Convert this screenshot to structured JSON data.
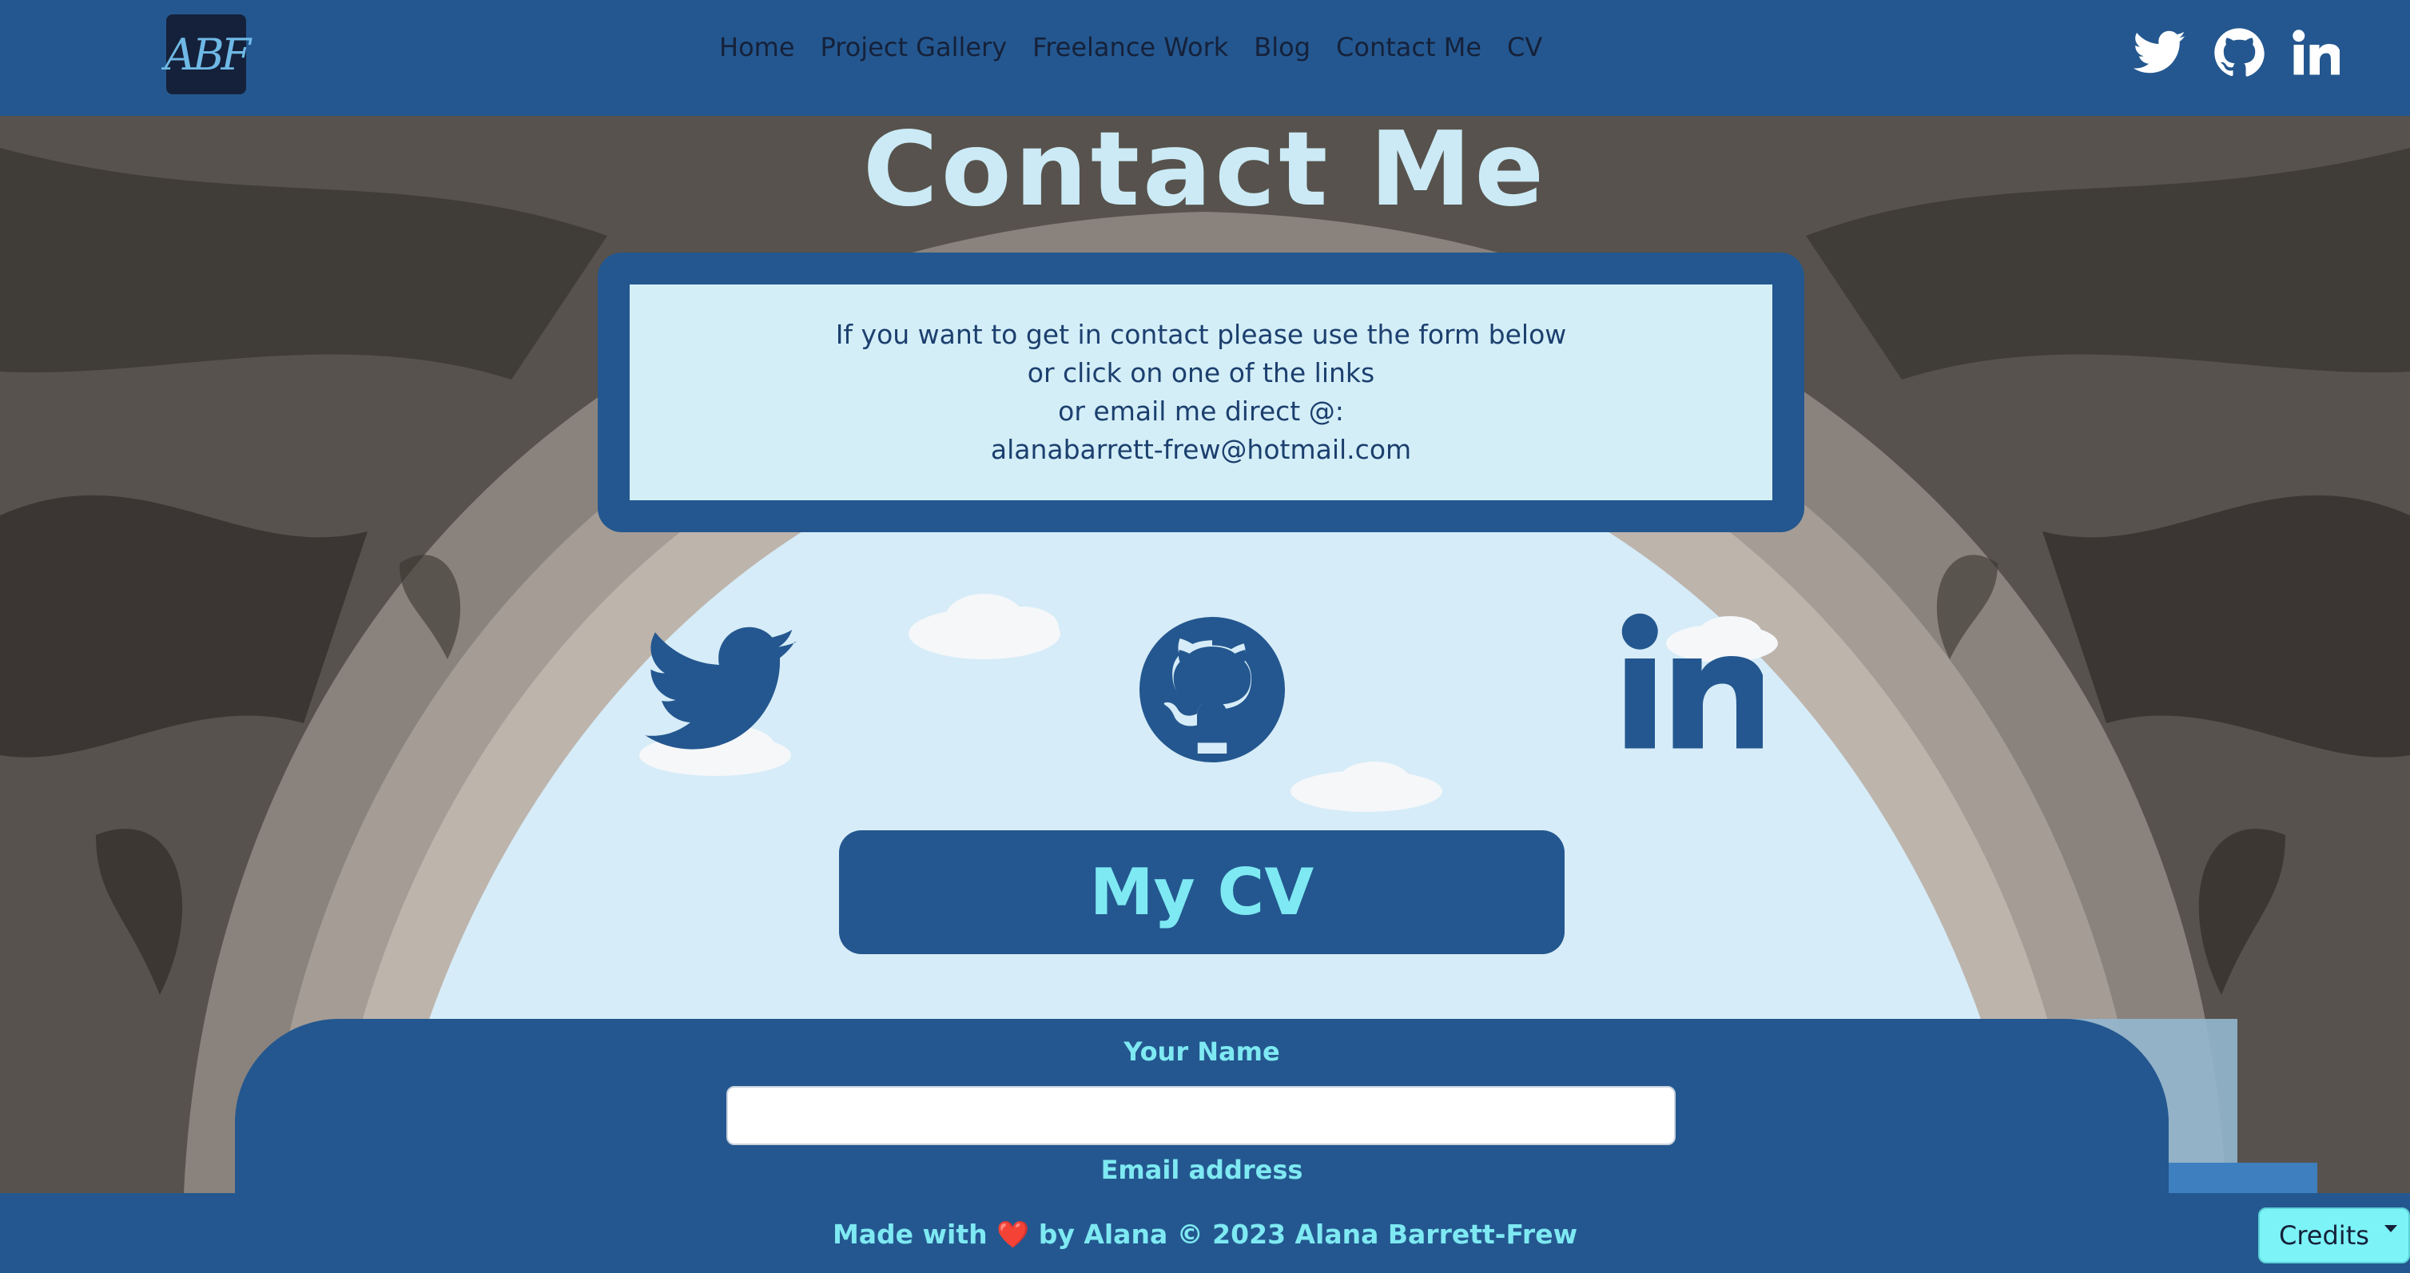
{
  "header": {
    "logo_text": "ABF",
    "nav": [
      "Home",
      "Project Gallery",
      "Freelance Work",
      "Blog",
      "Contact Me",
      "CV"
    ],
    "social_icons": [
      "twitter-icon",
      "github-icon",
      "linkedin-icon"
    ]
  },
  "main": {
    "title": "Contact Me",
    "info_lines": [
      "If you want to get in contact please use the form below",
      "or click on one of the links",
      "or email me direct @:",
      "alanabarrett-frew@hotmail.com"
    ],
    "social_links": [
      "twitter-icon",
      "github-icon",
      "linkedin-icon"
    ],
    "cv_button": "My CV"
  },
  "form": {
    "name_label": "Your Name",
    "name_value": "",
    "email_label": "Email address"
  },
  "footer": {
    "text_before": "Made with",
    "heart": "❤️",
    "text_after": "by Alana © 2023 Alana Barrett-Frew",
    "credits": "Credits"
  },
  "colors": {
    "primary": "#24578f",
    "accent": "#7ee9f2",
    "info_bg": "#d3eef7",
    "sky": "#d6ecf8",
    "dark": "#15213a"
  }
}
